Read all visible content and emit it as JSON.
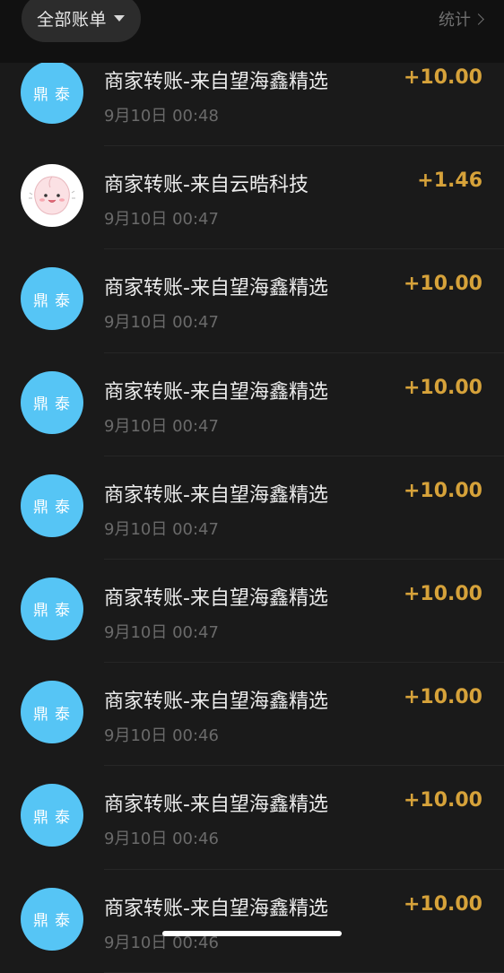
{
  "header": {
    "filter_label": "全部账单",
    "stats_label": "统计"
  },
  "colors": {
    "background": "#1a1a1a",
    "header_background": "#111111",
    "avatar_blue": "#56c5f5",
    "amount_gold": "#d6a23a"
  },
  "transactions": [
    {
      "avatar_text": "鼎泰",
      "avatar_type": "logo",
      "title": "商家转账-来自望海鑫精选",
      "time": "9月10日 00:48",
      "amount": "+10.00"
    },
    {
      "avatar_text": "",
      "avatar_type": "peach-cartoon-icon",
      "title": "商家转账-来自云晧科技",
      "time": "9月10日 00:47",
      "amount": "+1.46"
    },
    {
      "avatar_text": "鼎泰",
      "avatar_type": "logo",
      "title": "商家转账-来自望海鑫精选",
      "time": "9月10日 00:47",
      "amount": "+10.00"
    },
    {
      "avatar_text": "鼎泰",
      "avatar_type": "logo",
      "title": "商家转账-来自望海鑫精选",
      "time": "9月10日 00:47",
      "amount": "+10.00"
    },
    {
      "avatar_text": "鼎泰",
      "avatar_type": "logo",
      "title": "商家转账-来自望海鑫精选",
      "time": "9月10日 00:47",
      "amount": "+10.00"
    },
    {
      "avatar_text": "鼎泰",
      "avatar_type": "logo",
      "title": "商家转账-来自望海鑫精选",
      "time": "9月10日 00:47",
      "amount": "+10.00"
    },
    {
      "avatar_text": "鼎泰",
      "avatar_type": "logo",
      "title": "商家转账-来自望海鑫精选",
      "time": "9月10日 00:46",
      "amount": "+10.00"
    },
    {
      "avatar_text": "鼎泰",
      "avatar_type": "logo",
      "title": "商家转账-来自望海鑫精选",
      "time": "9月10日 00:46",
      "amount": "+10.00"
    },
    {
      "avatar_text": "鼎泰",
      "avatar_type": "logo",
      "title": "商家转账-来自望海鑫精选",
      "time": "9月10日 00:46",
      "amount": "+10.00"
    }
  ]
}
